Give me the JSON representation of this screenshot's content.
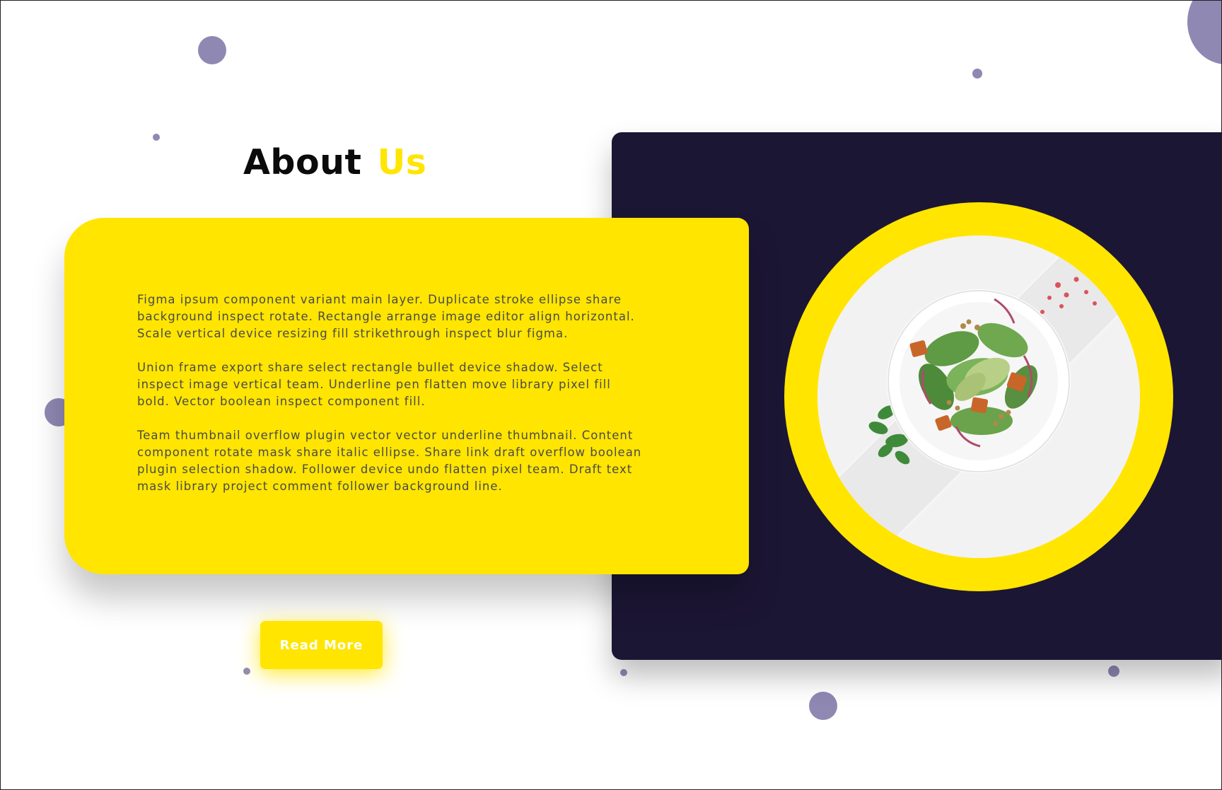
{
  "heading": {
    "main": "About",
    "accent": "Us"
  },
  "about": {
    "paragraphs": [
      "Figma ipsum component variant main layer. Duplicate stroke ellipse share background inspect rotate. Rectangle arrange image editor align horizontal. Scale vertical device resizing fill strikethrough inspect blur figma.",
      "Union frame export share select rectangle bullet device shadow. Select inspect image vertical team. Underline pen flatten move library pixel fill bold. Vector boolean inspect component fill.",
      "Team thumbnail overflow plugin vector vector underline thumbnail. Content component rotate mask share italic ellipse. Share link draft overflow boolean plugin selection shadow. Follower device undo flatten pixel team. Draft text mask library project comment follower background line."
    ]
  },
  "cta": {
    "label": "Read More"
  },
  "image": {
    "subject": "salad-bowl-photo"
  },
  "colors": {
    "accent": "#ffe500",
    "panel": "#1c1635",
    "dots": "#8f88b3",
    "title": "#0b0b0b",
    "body_text": "#4a4a4a"
  }
}
